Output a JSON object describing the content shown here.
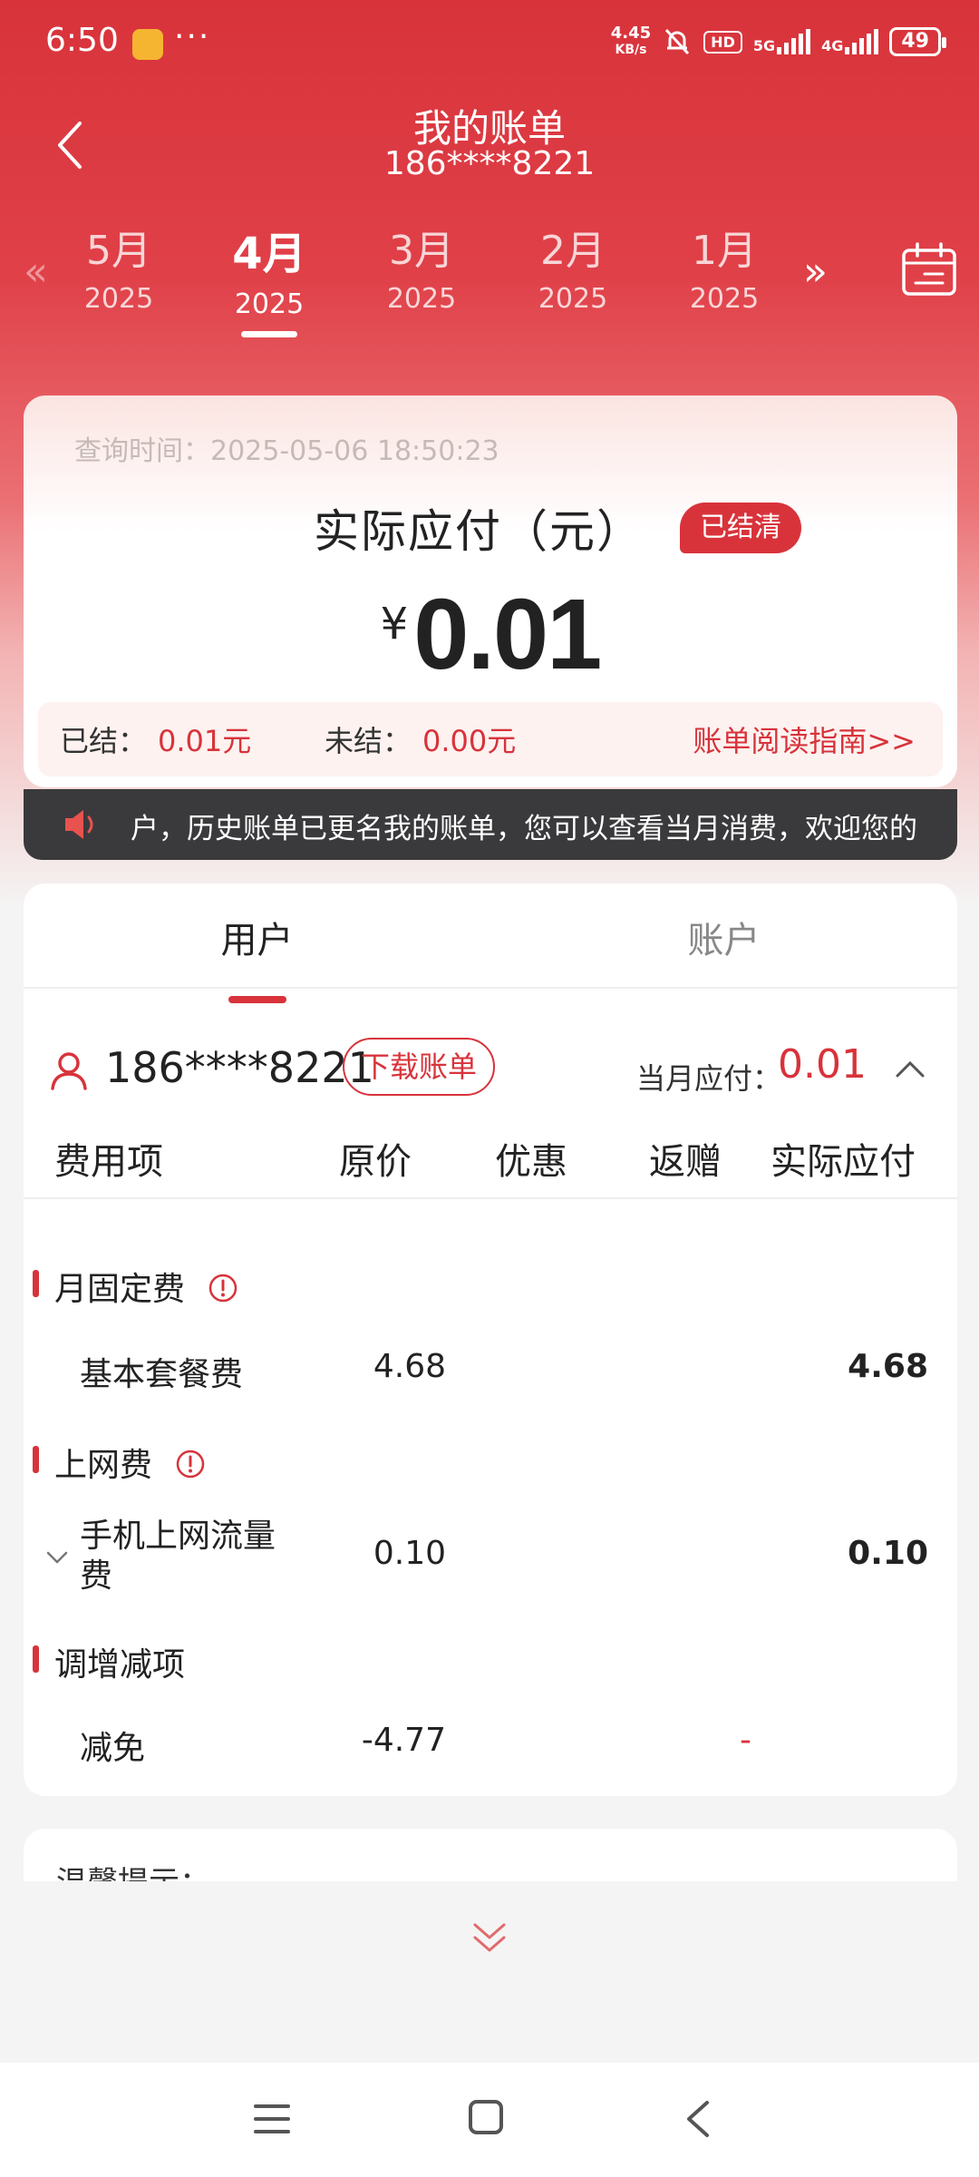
{
  "status_bar": {
    "time": "6:50",
    "dots": "···",
    "net_speed_value": "4.45",
    "net_speed_unit": "KB/s",
    "hd_label": "HD",
    "net1": "5G",
    "net2": "4G",
    "battery": "49"
  },
  "header": {
    "title": "我的账单",
    "phone": "186****8221"
  },
  "months": [
    {
      "month": "5月",
      "year": "2025"
    },
    {
      "month": "4月",
      "year": "2025",
      "active": true
    },
    {
      "month": "3月",
      "year": "2025"
    },
    {
      "month": "2月",
      "year": "2025"
    },
    {
      "month": "1月",
      "year": "2025"
    }
  ],
  "month_arrows": {
    "prev": "«",
    "next": "»"
  },
  "summary": {
    "query_time": "查询时间：2025-05-06 18:50:23",
    "due_label": "实际应付（元）",
    "status_badge": "已结清",
    "currency": "¥",
    "amount": "0.01",
    "settled_label": "已结：",
    "settled_value": "0.01元",
    "unsettled_label": "未结：",
    "unsettled_value": "0.00元",
    "guide_link": "账单阅读指南>>"
  },
  "notice": {
    "text": "户，历史账单已更名我的账单，您可以查看当月消费，欢迎您的"
  },
  "tabs": {
    "user": "用户",
    "account": "账户"
  },
  "user_row": {
    "phone": "186****8221",
    "download_button": "下载账单",
    "month_due_label": "当月应付：",
    "month_due_value": "0.01"
  },
  "table": {
    "headers": {
      "item": "费用项",
      "original": "原价",
      "discount": "优惠",
      "refund": "返赠",
      "actual": "实际应付"
    },
    "sections": [
      {
        "title": "月固定费",
        "label": "基本套餐费",
        "original": "4.68",
        "actual": "4.68"
      },
      {
        "title": "上网费",
        "label_line1": "手机上网流量",
        "label_line2": "费",
        "original": "0.10",
        "actual": "0.10"
      },
      {
        "title": "调增减项",
        "label": "减免",
        "original": "-4.77",
        "actual": "-"
      }
    ]
  },
  "tips": {
    "title": "温馨提示："
  },
  "colors": {
    "brand_red": "#d8333b",
    "notice_bg": "#3a3a3c"
  }
}
